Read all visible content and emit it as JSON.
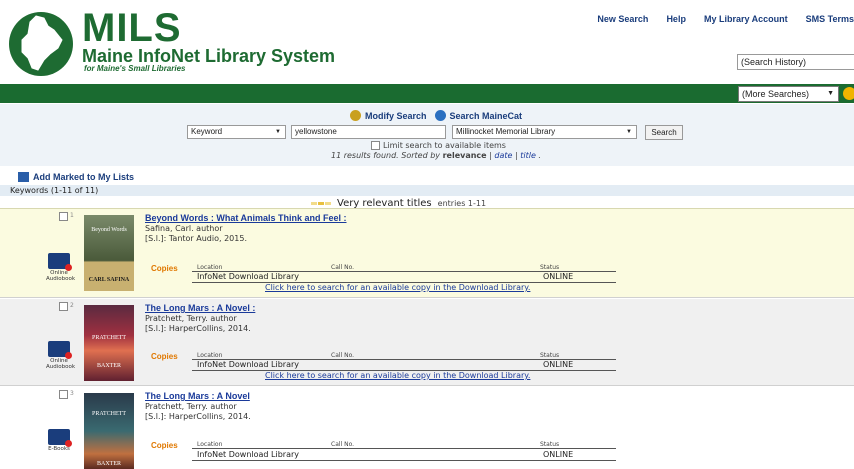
{
  "header": {
    "nav": [
      "New Search",
      "Help",
      "My Library Account",
      "SMS Terms"
    ],
    "logo_title": "MILS",
    "logo_subtitle": "Maine InfoNet Library System",
    "logo_tagline": "for Maine's Small Libraries",
    "search_history": "(Search History)",
    "more_searches": "(More Searches)"
  },
  "search": {
    "modify_label": "Modify Search",
    "maine_cat_label": "Search MaineCat",
    "type": "Keyword",
    "query": "yellowstone",
    "library": "Millinocket Memorial Library",
    "button": "Search",
    "limit_label": "Limit search to available items",
    "results_count_text": "11 results found.",
    "sorted_prefix": "Sorted by",
    "sorted_by": "relevance",
    "sort_sep": "|",
    "sort_date": "date",
    "sort_title": "title",
    "sort_end": "."
  },
  "list_actions": {
    "add_marked": "Add Marked to My Lists",
    "keywords_range": "Keywords (1-11 of 11)"
  },
  "relevance": {
    "label": "Very relevant titles",
    "entries": "entries 1-11"
  },
  "copies_headers": {
    "copies": "Copies",
    "location": "Location",
    "call_no": "Call No.",
    "status": "Status"
  },
  "results": [
    {
      "number": "1",
      "title": "Beyond Words : What Animals Think and Feel :",
      "author": "Safina, Carl. author",
      "pub": "[S.l.]: Tantor Audio, 2015.",
      "format": "Online Audiobook",
      "cover_top": "Beyond Words",
      "cover_bottom": "CARL SAFINA",
      "location": "InfoNet Download Library",
      "status": "ONLINE",
      "download_link": "Click here to search for an available copy in the Download Library."
    },
    {
      "number": "2",
      "title": "The Long Mars : A Novel :",
      "author": "Pratchett, Terry. author",
      "pub": "[S.l.]: HarperCollins, 2014.",
      "format": "Online Audiobook",
      "cover_top": "PRATCHETT",
      "cover_bottom": "BAXTER",
      "location": "InfoNet Download Library",
      "status": "ONLINE",
      "download_link": "Click here to search for an available copy in the Download Library."
    },
    {
      "number": "3",
      "title": "The Long Mars : A Novel",
      "author": "Pratchett, Terry. author",
      "pub": "[S.l.]: HarperCollins, 2014.",
      "format": "E-Books",
      "cover_top": "PRATCHETT",
      "cover_bottom": "BAXTER",
      "location": "InfoNet Download Library",
      "status": "ONLINE"
    }
  ],
  "colors": {
    "brand_green": "#1e6b32",
    "bar_green": "#1a6b30",
    "link_blue": "#1a3a9a",
    "copies_orange": "#e07800",
    "highlight_row": "#fbfbe0"
  }
}
